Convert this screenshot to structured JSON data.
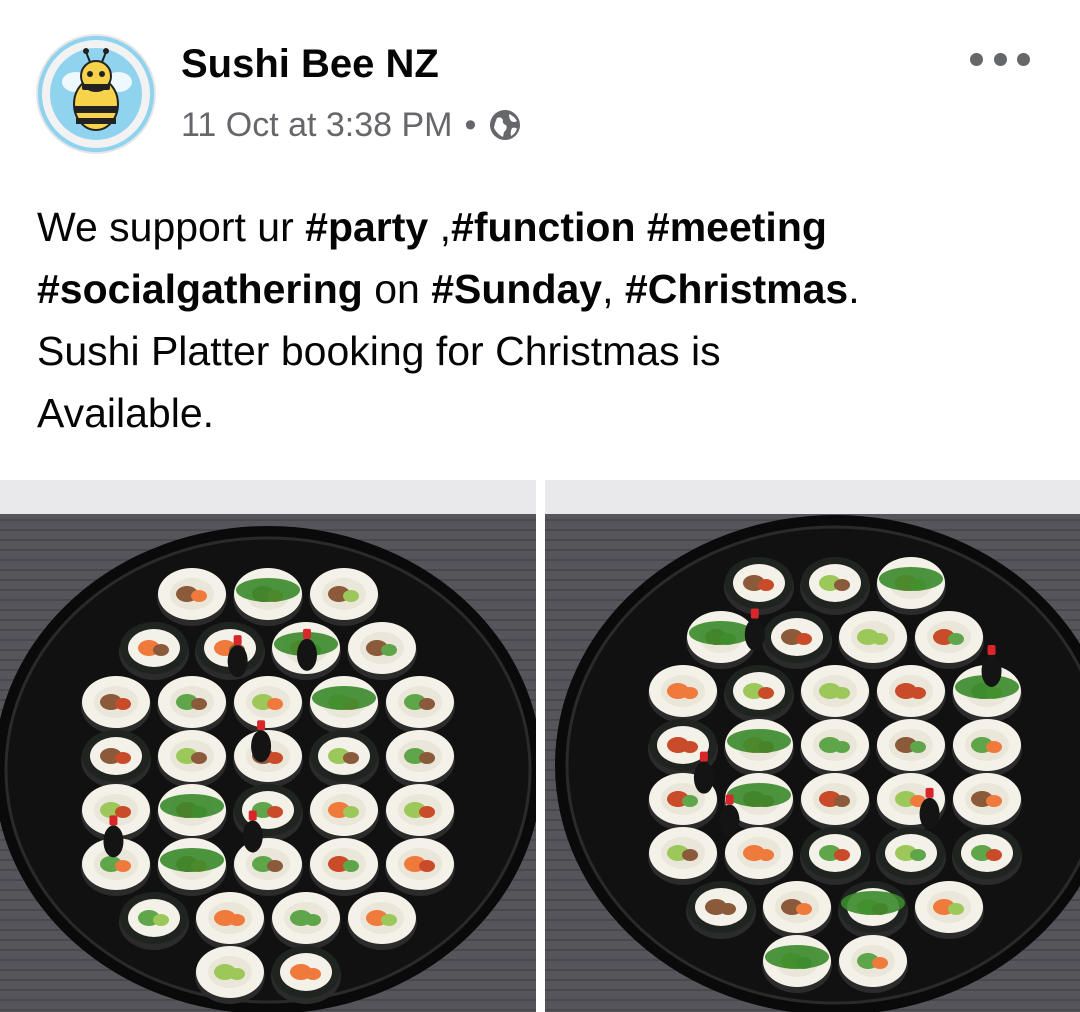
{
  "post": {
    "page_name": "Sushi Bee NZ",
    "timestamp": "11 Oct at 3:38 PM",
    "separator": "•",
    "privacy_icon": "globe-icon",
    "more_icon": "more-options-icon"
  },
  "text": {
    "seg1": "We support ur ",
    "tag_party": "#party",
    "seg2": " ,",
    "tag_function": "#function",
    "seg3": " ",
    "tag_meeting": "#meeting",
    "tag_social": "#socialgathering",
    "seg4": " on ",
    "tag_sunday": "#Sunday",
    "seg5": ", ",
    "tag_christmas": "#Christmas",
    "seg6": ".",
    "line3": "Sushi Platter booking for Christmas is",
    "line4": "Available."
  },
  "colors": {
    "name": "#050505",
    "meta": "#65676b",
    "tray": "#111111",
    "rice": "#f4f1e8",
    "nori": "#1f2420",
    "salmon": "#f07a3c",
    "avocado": "#9cc85a"
  }
}
